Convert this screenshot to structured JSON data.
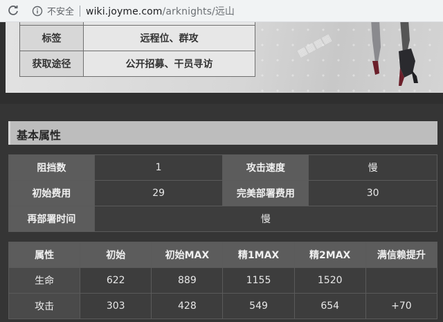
{
  "browser": {
    "security_label": "不安全",
    "url_host": "wiki.joyme.com",
    "url_path": "/arknights/远山"
  },
  "top_table": {
    "rows": [
      {
        "label": "标签",
        "value": "远程位、群攻"
      },
      {
        "label": "获取途径",
        "value": "公开招募、干员寻访"
      }
    ]
  },
  "section": {
    "title": "基本属性"
  },
  "basic": {
    "block_label": "阻挡数",
    "block_value": "1",
    "speed_label": "攻击速度",
    "speed_value": "慢",
    "cost_label": "初始费用",
    "cost_value": "29",
    "max_cost_label": "完美部署费用",
    "max_cost_value": "30",
    "redeploy_label": "再部署时间",
    "redeploy_value": "慢"
  },
  "stats": {
    "headers": [
      "属性",
      "初始",
      "初始MAX",
      "精1MAX",
      "精2MAX",
      "满信赖提升"
    ],
    "rows": [
      {
        "name": "生命",
        "values": [
          "622",
          "889",
          "1155",
          "1520",
          ""
        ]
      },
      {
        "name": "攻击",
        "values": [
          "303",
          "428",
          "549",
          "654",
          "+70"
        ]
      }
    ]
  }
}
